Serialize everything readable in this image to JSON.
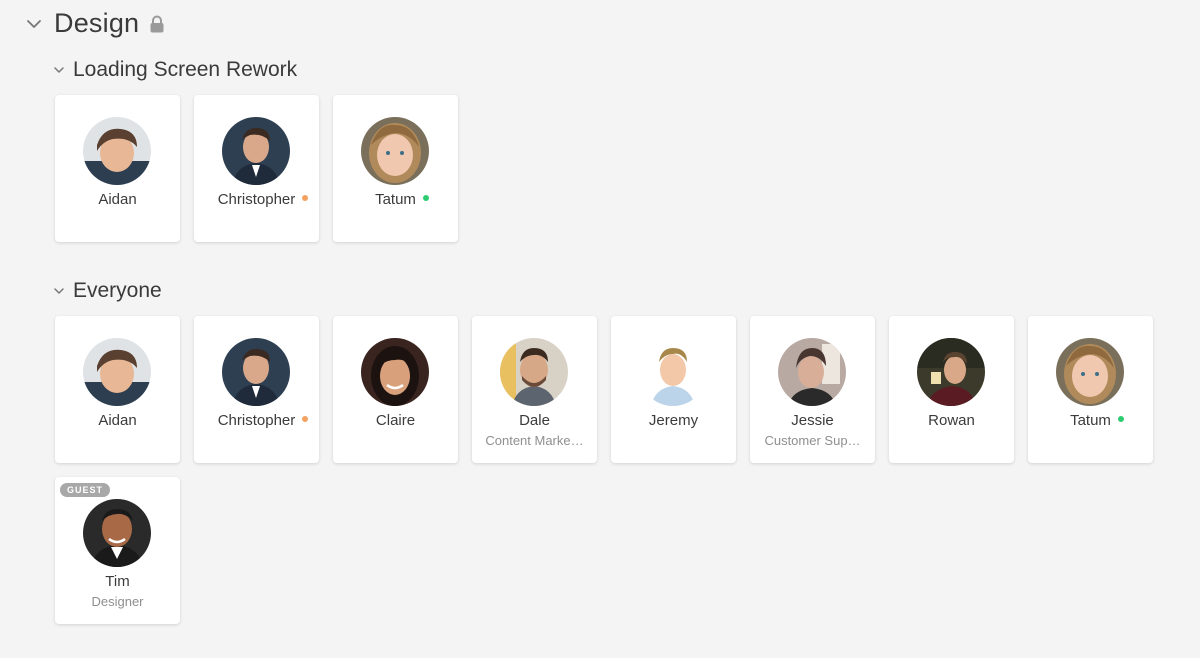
{
  "group": {
    "title": "Design"
  },
  "sections": [
    {
      "title": "Loading Screen Rework",
      "members": [
        {
          "name": "Aidan",
          "role": "",
          "status": "",
          "avatar": "aidan"
        },
        {
          "name": "Christopher",
          "role": "",
          "status": "away",
          "avatar": "christopher"
        },
        {
          "name": "Tatum",
          "role": "",
          "status": "online",
          "avatar": "tatum"
        }
      ]
    },
    {
      "title": "Everyone",
      "members": [
        {
          "name": "Aidan",
          "role": "",
          "status": "",
          "avatar": "aidan"
        },
        {
          "name": "Christopher",
          "role": "",
          "status": "away",
          "avatar": "christopher"
        },
        {
          "name": "Claire",
          "role": "",
          "status": "",
          "avatar": "claire"
        },
        {
          "name": "Dale",
          "role": "Content Marke…",
          "status": "",
          "avatar": "dale"
        },
        {
          "name": "Jeremy",
          "role": "",
          "status": "",
          "avatar": "jeremy"
        },
        {
          "name": "Jessie",
          "role": "Customer Sup…",
          "status": "",
          "avatar": "jessie"
        },
        {
          "name": "Rowan",
          "role": "",
          "status": "",
          "avatar": "rowan"
        },
        {
          "name": "Tatum",
          "role": "",
          "status": "online",
          "avatar": "tatum"
        },
        {
          "name": "Tim",
          "role": "Designer",
          "status": "",
          "avatar": "tim",
          "badge": "GUEST"
        }
      ]
    }
  ],
  "status_colors": {
    "online": "#2ecc71",
    "away": "#f4a261"
  },
  "icons": {
    "collapse": "chevron-down-icon",
    "lock": "lock-icon"
  }
}
